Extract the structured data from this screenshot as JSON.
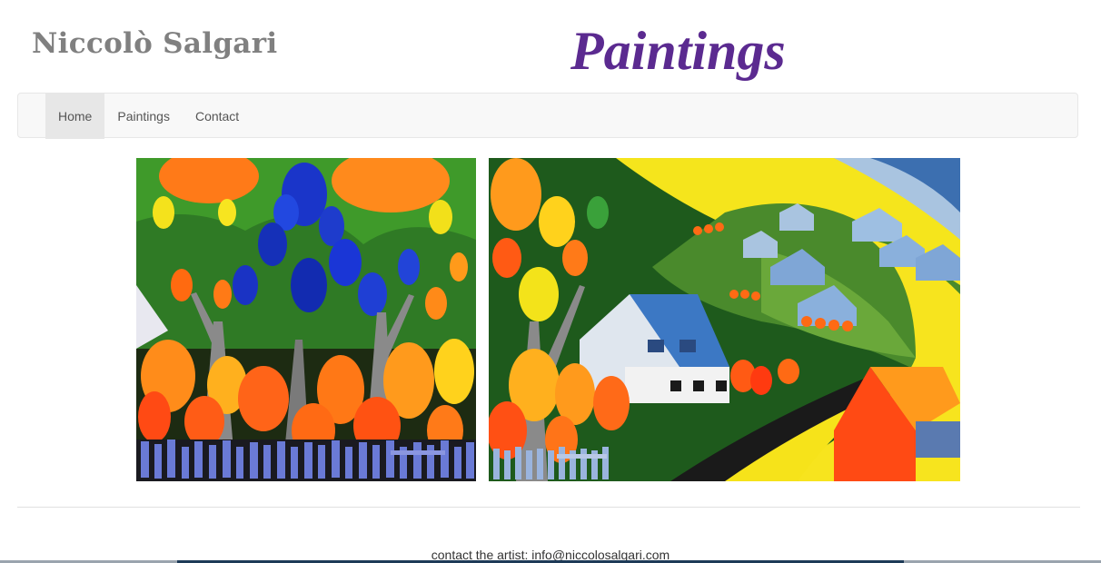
{
  "header": {
    "site_name": "Niccolò Salgari",
    "page_heading": "Paintings"
  },
  "nav": {
    "items": [
      {
        "label": "Home",
        "active": true
      },
      {
        "label": "Paintings",
        "active": false
      },
      {
        "label": "Contact",
        "active": false
      }
    ]
  },
  "gallery": {
    "paintings": [
      {
        "name": "painting-trees"
      },
      {
        "name": "painting-village"
      }
    ]
  },
  "footer": {
    "contact_text": "contact the artist: info@niccolosalgari.com"
  },
  "colors": {
    "heading": "#5b2a90",
    "site_name": "#808080",
    "navbar_bg": "#f8f8f8",
    "nav_active_bg": "#e7e7e7"
  }
}
